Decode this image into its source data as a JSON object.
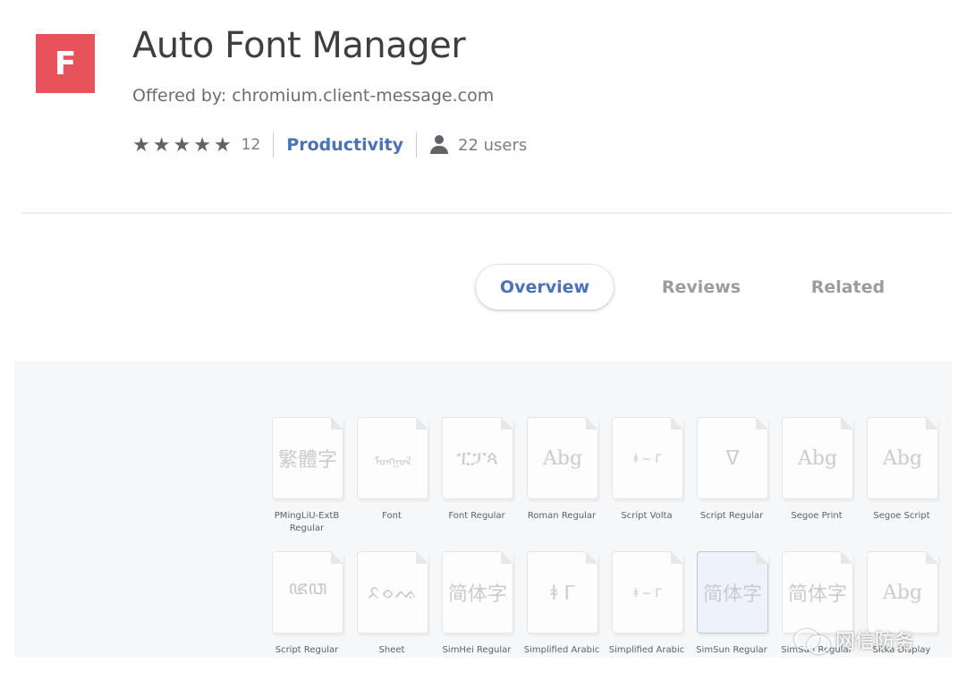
{
  "extension": {
    "logo_letter": "F",
    "logo_color": "#e8525a",
    "title": "Auto Font Manager",
    "offered_by": "Offered by: chromium.client-message.com",
    "rating_stars": 5,
    "rating_count": "12",
    "category": "Productivity",
    "users": "22 users"
  },
  "tabs": [
    {
      "label": "Overview",
      "active": true
    },
    {
      "label": "Reviews",
      "active": false
    },
    {
      "label": "Related",
      "active": false
    }
  ],
  "fonts": {
    "row1": [
      {
        "preview": "繁體字",
        "name": "PMingLiU-ExtB Regular"
      },
      {
        "preview": "ᠮᠣᠩᠭᠣᠯ",
        "name": "Font"
      },
      {
        "preview": "ፒፓጳ",
        "name": "Font Regular"
      },
      {
        "preview": "Abg",
        "name": "Roman Regular"
      },
      {
        "preview": "ꬸ ~ ᒥ",
        "name": "Script Volta"
      },
      {
        "preview": "ᐁ",
        "name": "Script Regular"
      },
      {
        "preview": "Abg",
        "name": "Segoe Print"
      },
      {
        "preview": "Abg",
        "name": "Segoe Script"
      }
    ],
    "row2": [
      {
        "preview": "ꦗꦮ",
        "name": "Script Regular"
      },
      {
        "preview": "ᨅᨔᨕ",
        "name": "Sheet"
      },
      {
        "preview": "简体字",
        "name": "SimHei Regular"
      },
      {
        "preview": "ꬸ ᒥ",
        "name": "Simplified Arabic"
      },
      {
        "preview": "ꬸ ~ ᒥ",
        "name": "Simplified Arabic"
      },
      {
        "preview": "简体字",
        "name": "SimSun Regular"
      },
      {
        "preview": "简体字",
        "name": "SimSun Regular"
      },
      {
        "preview": "Abg",
        "name": "Sitka Display"
      }
    ]
  },
  "watermark": {
    "icon": "wechat-icon",
    "text": "网信防务"
  }
}
